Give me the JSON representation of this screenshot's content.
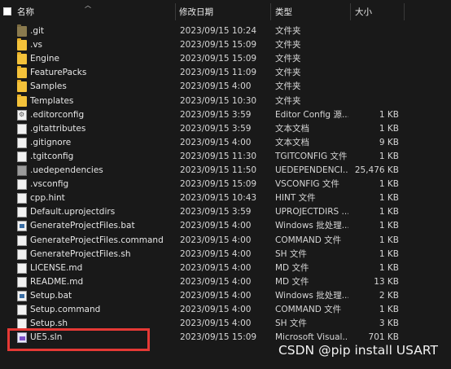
{
  "header": {
    "name": "名称",
    "date": "修改日期",
    "type": "类型",
    "size": "大小"
  },
  "files": [
    {
      "name": ".git",
      "date": "2023/09/15 10:24",
      "type": "文件夹",
      "size": "",
      "icon": "folder-dark"
    },
    {
      "name": ".vs",
      "date": "2023/09/15 15:09",
      "type": "文件夹",
      "size": "",
      "icon": "folder"
    },
    {
      "name": "Engine",
      "date": "2023/09/15 15:09",
      "type": "文件夹",
      "size": "",
      "icon": "folder"
    },
    {
      "name": "FeaturePacks",
      "date": "2023/09/15 11:09",
      "type": "文件夹",
      "size": "",
      "icon": "folder"
    },
    {
      "name": "Samples",
      "date": "2023/09/15 4:00",
      "type": "文件夹",
      "size": "",
      "icon": "folder"
    },
    {
      "name": "Templates",
      "date": "2023/09/15 10:30",
      "type": "文件夹",
      "size": "",
      "icon": "folder"
    },
    {
      "name": ".editorconfig",
      "date": "2023/09/15 3:59",
      "type": "Editor Config 源...",
      "size": "1 KB",
      "icon": "file-gear"
    },
    {
      "name": ".gitattributes",
      "date": "2023/09/15 3:59",
      "type": "文本文档",
      "size": "1 KB",
      "icon": "file"
    },
    {
      "name": ".gitignore",
      "date": "2023/09/15 4:00",
      "type": "文本文档",
      "size": "9 KB",
      "icon": "file"
    },
    {
      "name": ".tgitconfig",
      "date": "2023/09/15 11:30",
      "type": "TGITCONFIG 文件",
      "size": "1 KB",
      "icon": "file"
    },
    {
      "name": ".uedependencies",
      "date": "2023/09/15 11:50",
      "type": "UEDEPENDENCI...",
      "size": "25,476 KB",
      "icon": "file-gray"
    },
    {
      "name": ".vsconfig",
      "date": "2023/09/15 15:09",
      "type": "VSCONFIG 文件",
      "size": "1 KB",
      "icon": "file"
    },
    {
      "name": "cpp.hint",
      "date": "2023/09/15 10:43",
      "type": "HINT 文件",
      "size": "1 KB",
      "icon": "file"
    },
    {
      "name": "Default.uprojectdirs",
      "date": "2023/09/15 3:59",
      "type": "UPROJECTDIRS ...",
      "size": "1 KB",
      "icon": "file"
    },
    {
      "name": "GenerateProjectFiles.bat",
      "date": "2023/09/15 4:00",
      "type": "Windows 批处理...",
      "size": "1 KB",
      "icon": "file-bat"
    },
    {
      "name": "GenerateProjectFiles.command",
      "date": "2023/09/15 4:00",
      "type": "COMMAND 文件",
      "size": "1 KB",
      "icon": "file"
    },
    {
      "name": "GenerateProjectFiles.sh",
      "date": "2023/09/15 4:00",
      "type": "SH 文件",
      "size": "1 KB",
      "icon": "file"
    },
    {
      "name": "LICENSE.md",
      "date": "2023/09/15 4:00",
      "type": "MD 文件",
      "size": "1 KB",
      "icon": "file"
    },
    {
      "name": "README.md",
      "date": "2023/09/15 4:00",
      "type": "MD 文件",
      "size": "13 KB",
      "icon": "file"
    },
    {
      "name": "Setup.bat",
      "date": "2023/09/15 4:00",
      "type": "Windows 批处理...",
      "size": "2 KB",
      "icon": "file-bat"
    },
    {
      "name": "Setup.command",
      "date": "2023/09/15 4:00",
      "type": "COMMAND 文件",
      "size": "1 KB",
      "icon": "file"
    },
    {
      "name": "Setup.sh",
      "date": "2023/09/15 4:00",
      "type": "SH 文件",
      "size": "3 KB",
      "icon": "file"
    },
    {
      "name": "UE5.sln",
      "date": "2023/09/15 15:09",
      "type": "Microsoft Visual...",
      "size": "701 KB",
      "icon": "file-sln"
    }
  ],
  "watermark": "CSDN @pip install USART",
  "colors": {
    "background": "#191919",
    "highlight": "#e53935",
    "folder": "#f4c23a"
  }
}
